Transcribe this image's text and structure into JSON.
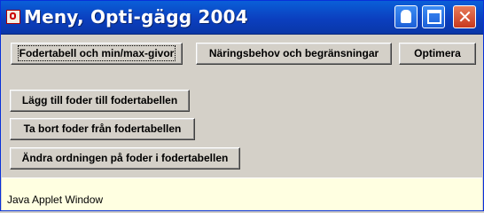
{
  "window": {
    "title": "Meny, Opti-gägg 2004",
    "controls": {
      "minimize": "minimize-icon",
      "maximize": "maximize-icon",
      "close": "✕"
    }
  },
  "top_buttons": [
    {
      "label": "Fodertabell och min/max-givor"
    },
    {
      "label": "Näringsbehov och begränsningar"
    },
    {
      "label": "Optimera"
    }
  ],
  "action_buttons": [
    {
      "label": "Lägg till foder till fodertabellen"
    },
    {
      "label": "Ta bort foder från fodertabellen"
    },
    {
      "label": "Ändra ordningen på foder i fodertabellen"
    }
  ],
  "status": {
    "text": "Java Applet Window"
  },
  "colors": {
    "titlebar": "#0b3fbf",
    "panel": "#d4d0c8",
    "status_bg": "#ffffe1",
    "close_button": "#c8391e"
  }
}
